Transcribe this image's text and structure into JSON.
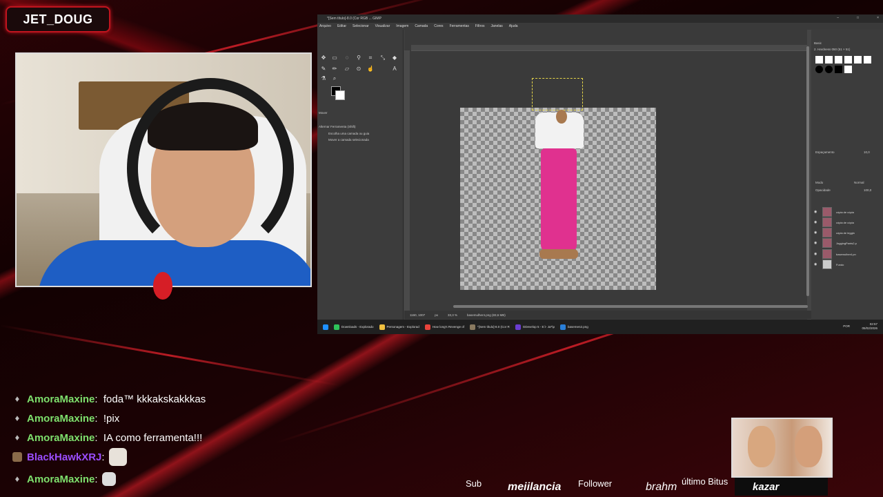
{
  "overlay": {
    "streamer_name": "JET_DOUG",
    "bottom_bar": {
      "sub_label": "Sub",
      "sub_name": "meiilancia",
      "follower_label": "Follower",
      "follower_name": "brahm",
      "bits_label": "último Bitus",
      "bits_name": "kazar"
    }
  },
  "chat": [
    {
      "user": "AmoraMaxine",
      "color": "#7ee06d",
      "text": "foda™ kkkakskakkkas"
    },
    {
      "user": "AmoraMaxine",
      "color": "#7ee06d",
      "text": "!pix"
    },
    {
      "user": "AmoraMaxine",
      "color": "#7ee06d",
      "text": "IA como ferramenta!!!"
    },
    {
      "user": "BlackHawkXRJ",
      "color": "#9b4dff",
      "text": ""
    },
    {
      "user": "AmoraMaxine",
      "color": "#7ee06d",
      "text": ""
    }
  ],
  "gimp": {
    "title": "*[Sem título]-8.0 (Cor RGB ... GIMP",
    "menu": [
      "Arquivo",
      "Editar",
      "Selecionar",
      "Visualizar",
      "Imagem",
      "Camada",
      "Cores",
      "Ferramentas",
      "Filtros",
      "Janelas",
      "Ajuda"
    ],
    "tool_options": {
      "heading": "Mover",
      "sub": "Alternar Ferramenta (Shift)",
      "opt1": "Escolha uma camada ou guia",
      "opt2": "Mover a camada selecionada"
    },
    "status": {
      "coords": "1160, 1007",
      "unit": "px",
      "zoom": "33,3 %",
      "file": "basemulher4.png (83,6 MB)"
    },
    "right_panel": {
      "brush_set": "Basic",
      "brush_name": "2. Hardness 050 (51 × 51)",
      "spacing_label": "Espaçamento",
      "spacing_value": "10,0",
      "mode_label": "Modo",
      "mode_value": "Normal",
      "opacity_label": "Opacidade",
      "opacity_value": "100,0"
    },
    "layers": [
      "cópia de cópia",
      "cópia de cópia",
      "cópia de leggin",
      "JoggingPants2.p",
      "basemulher4.pn",
      "Fundo"
    ]
  },
  "taskbar": {
    "items": [
      "Downloads - Explorado",
      "Personagem - Explorad",
      "How long's Revenge of",
      "*[Sem título]-8.0 (Cor R",
      "GDevelop 5 - E:\\- Ja*\\p",
      "basemen2.png"
    ],
    "lang": "POR",
    "time": "02:57",
    "date": "05/02/2026"
  }
}
